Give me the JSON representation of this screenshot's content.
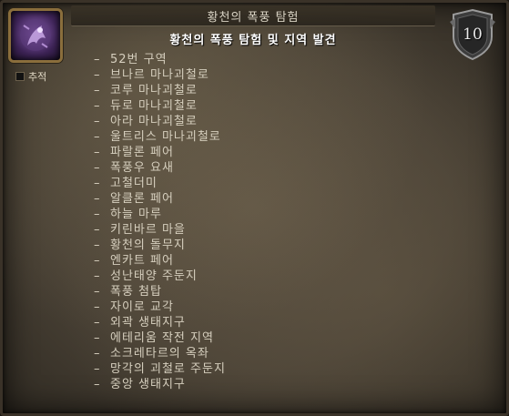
{
  "achievement": {
    "title": "황천의 폭풍 탐험",
    "subtitle": "황천의 폭풍 탐험 및 지역 발견",
    "points": "10",
    "track_label": "추적",
    "icon": "purple-nether-creature-icon"
  },
  "criteria": [
    "52번 구역",
    "브나르 마나괴철로",
    "코루 마나괴철로",
    "듀로 마나괴철로",
    "아라 마나괴철로",
    "울트리스 마나괴철로",
    "파랄론 페어",
    "폭풍우 요새",
    "고철더미",
    "알클론 페어",
    "하늘 마루",
    "키린바르 마을",
    "황천의 돌무지",
    "엔카트 페어",
    "성난태양 주둔지",
    "폭풍 첨탑",
    "자이로 교각",
    "외곽 생태지구",
    "에테리움 작전 지역",
    "소크레타르의 옥좌",
    "망각의 괴철로 주둔지",
    "중앙 생태지구"
  ],
  "dash": "–",
  "colors": {
    "parchment": "#4a4236",
    "text": "#d6cfbe",
    "title": "#d9d3c4",
    "icon_border": "#8a6e3c"
  }
}
